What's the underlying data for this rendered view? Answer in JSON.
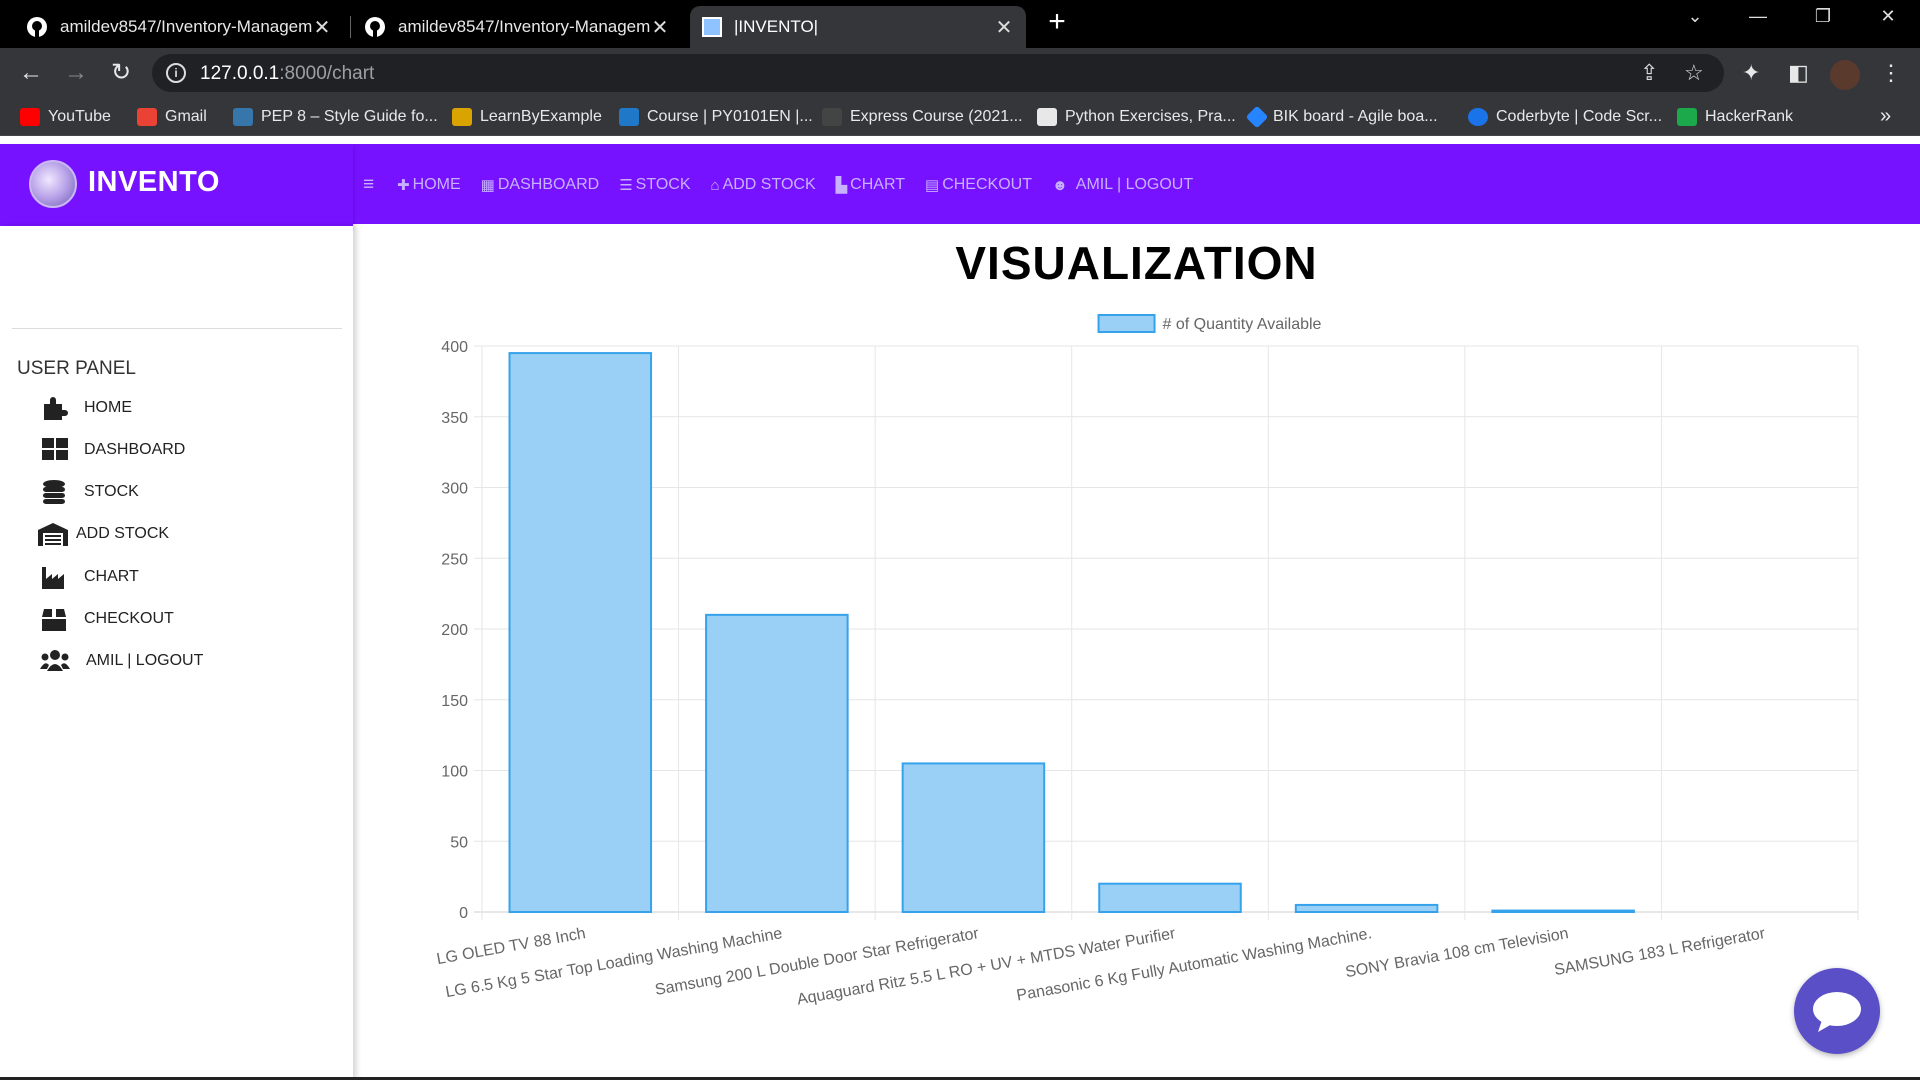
{
  "browser": {
    "tabs": [
      {
        "title": "amildev8547/Inventory-Managemen",
        "icon": "github-icon"
      },
      {
        "title": "amildev8547/Inventory-Managemen",
        "icon": "github-icon"
      },
      {
        "title": "|INVENTO|",
        "icon": "site-favicon"
      }
    ],
    "url_host": "127.0.0.1",
    "url_path": ":8000/chart",
    "bookmarks": [
      {
        "label": "YouTube",
        "color": "#ff0000"
      },
      {
        "label": "Gmail",
        "color": "#ea4335"
      },
      {
        "label": "PEP 8 – Style Guide fo...",
        "color": "#3776ab"
      },
      {
        "label": "LearnByExample",
        "color": "#d9a400"
      },
      {
        "label": "Course | PY0101EN |...",
        "color": "#1f78c8"
      },
      {
        "label": "Express Course (2021...",
        "color": "#444444"
      },
      {
        "label": "Python Exercises, Pra...",
        "color": "#e8e8e8"
      },
      {
        "label": "BIK board - Agile boa...",
        "color": "#2684ff"
      },
      {
        "label": "Coderbyte | Code Scr...",
        "color": "#1a73e8"
      },
      {
        "label": "HackerRank",
        "color": "#1ba94c"
      }
    ]
  },
  "app": {
    "brand": "INVENTO",
    "topnav": [
      {
        "label": "HOME",
        "icon": "puzzle-icon"
      },
      {
        "label": "DASHBOARD",
        "icon": "dashboard-icon"
      },
      {
        "label": "STOCK",
        "icon": "database-icon"
      },
      {
        "label": "ADD STOCK",
        "icon": "warehouse-icon"
      },
      {
        "label": "CHART",
        "icon": "chart-icon"
      },
      {
        "label": "CHECKOUT",
        "icon": "box-icon"
      },
      {
        "label": "AMIL | LOGOUT",
        "icon": "users-icon"
      }
    ],
    "sidebar": {
      "title": "USER PANEL",
      "items": [
        {
          "label": "HOME",
          "icon": "puzzle-icon"
        },
        {
          "label": "DASHBOARD",
          "icon": "dashboard-icon"
        },
        {
          "label": "STOCK",
          "icon": "database-icon"
        },
        {
          "label": "ADD STOCK",
          "icon": "warehouse-icon"
        },
        {
          "label": "CHART",
          "icon": "chart-icon"
        },
        {
          "label": "CHECKOUT",
          "icon": "box-icon"
        },
        {
          "label": "AMIL | LOGOUT",
          "icon": "users-icon"
        }
      ]
    },
    "page_title": "VISUALIZATION",
    "accent_color": "#7612ff"
  },
  "chart_data": {
    "type": "bar",
    "categories": [
      "LG OLED TV 88 Inch",
      "LG 6.5 Kg 5 Star Top Loading Washing Machine",
      "Samsung 200 L Double Door Star Refrigerator",
      "Aquaguard Ritz 5.5 L RO + UV + MTDS Water Purifier",
      "Panasonic 6 Kg Fully Automatic Washing Machine.",
      "SONY Bravia 108 cm Television",
      "SAMSUNG 183 L Refrigerator"
    ],
    "series": [
      {
        "name": "# of Quantity Available",
        "values": [
          395,
          210,
          105,
          20,
          5,
          1,
          0
        ],
        "color": "#9ad0f5",
        "border": "#36a2eb"
      }
    ],
    "ylim": [
      0,
      400
    ],
    "yticks": [
      0,
      50,
      100,
      150,
      200,
      250,
      300,
      350,
      400
    ],
    "grid": true,
    "legend": "top-center"
  }
}
